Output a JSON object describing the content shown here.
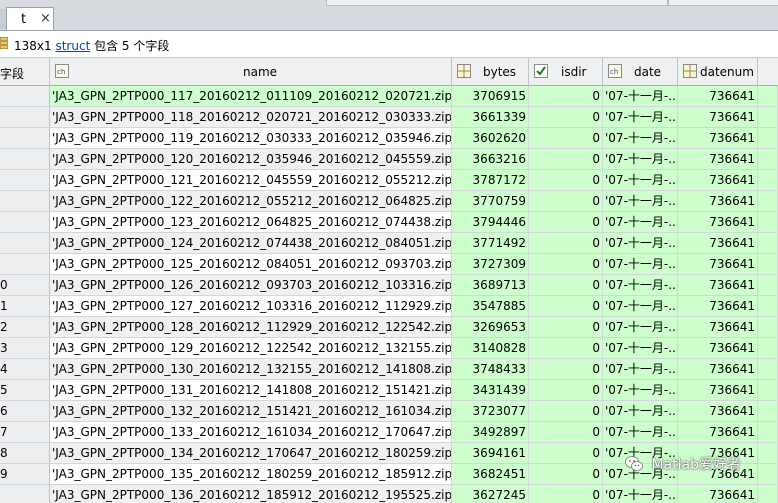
{
  "tab": {
    "label": "t",
    "close": "×"
  },
  "info": {
    "size": "138x1",
    "type_link": "struct",
    "suffix": "包含 5 个字段"
  },
  "columns": {
    "index": "字段",
    "name": "name",
    "bytes": "bytes",
    "isdir": "isdir",
    "date": "date",
    "datenum": "datenum"
  },
  "rows": [
    {
      "idx": "",
      "name": "'JA3_GPN_2PTP000_117_20160212_011109_20160212_020721.zip'",
      "bytes": "3706915",
      "isdir": "0",
      "date": "'07-十一月-...",
      "datenum": "736641"
    },
    {
      "idx": "",
      "name": "'JA3_GPN_2PTP000_118_20160212_020721_20160212_030333.zip'",
      "bytes": "3661339",
      "isdir": "0",
      "date": "'07-十一月-...",
      "datenum": "736641"
    },
    {
      "idx": "",
      "name": "'JA3_GPN_2PTP000_119_20160212_030333_20160212_035946.zip'",
      "bytes": "3602620",
      "isdir": "0",
      "date": "'07-十一月-...",
      "datenum": "736641"
    },
    {
      "idx": "",
      "name": "'JA3_GPN_2PTP000_120_20160212_035946_20160212_045559.zip'",
      "bytes": "3663216",
      "isdir": "0",
      "date": "'07-十一月-...",
      "datenum": "736641"
    },
    {
      "idx": "",
      "name": "'JA3_GPN_2PTP000_121_20160212_045559_20160212_055212.zip'",
      "bytes": "3787172",
      "isdir": "0",
      "date": "'07-十一月-...",
      "datenum": "736641"
    },
    {
      "idx": "",
      "name": "'JA3_GPN_2PTP000_122_20160212_055212_20160212_064825.zip'",
      "bytes": "3770759",
      "isdir": "0",
      "date": "'07-十一月-...",
      "datenum": "736641"
    },
    {
      "idx": "",
      "name": "'JA3_GPN_2PTP000_123_20160212_064825_20160212_074438.zip'",
      "bytes": "3794446",
      "isdir": "0",
      "date": "'07-十一月-...",
      "datenum": "736641"
    },
    {
      "idx": "",
      "name": "'JA3_GPN_2PTP000_124_20160212_074438_20160212_084051.zip'",
      "bytes": "3771492",
      "isdir": "0",
      "date": "'07-十一月-...",
      "datenum": "736641"
    },
    {
      "idx": "",
      "name": "'JA3_GPN_2PTP000_125_20160212_084051_20160212_093703.zip'",
      "bytes": "3727309",
      "isdir": "0",
      "date": "'07-十一月-...",
      "datenum": "736641"
    },
    {
      "idx": "0",
      "name": "'JA3_GPN_2PTP000_126_20160212_093703_20160212_103316.zip'",
      "bytes": "3689713",
      "isdir": "0",
      "date": "'07-十一月-...",
      "datenum": "736641"
    },
    {
      "idx": "1",
      "name": "'JA3_GPN_2PTP000_127_20160212_103316_20160212_112929.zip'",
      "bytes": "3547885",
      "isdir": "0",
      "date": "'07-十一月-...",
      "datenum": "736641"
    },
    {
      "idx": "2",
      "name": "'JA3_GPN_2PTP000_128_20160212_112929_20160212_122542.zip'",
      "bytes": "3269653",
      "isdir": "0",
      "date": "'07-十一月-...",
      "datenum": "736641"
    },
    {
      "idx": "3",
      "name": "'JA3_GPN_2PTP000_129_20160212_122542_20160212_132155.zip'",
      "bytes": "3140828",
      "isdir": "0",
      "date": "'07-十一月-...",
      "datenum": "736641"
    },
    {
      "idx": "4",
      "name": "'JA3_GPN_2PTP000_130_20160212_132155_20160212_141808.zip'",
      "bytes": "3748433",
      "isdir": "0",
      "date": "'07-十一月-...",
      "datenum": "736641"
    },
    {
      "idx": "5",
      "name": "'JA3_GPN_2PTP000_131_20160212_141808_20160212_151421.zip'",
      "bytes": "3431439",
      "isdir": "0",
      "date": "'07-十一月-...",
      "datenum": "736641"
    },
    {
      "idx": "6",
      "name": "'JA3_GPN_2PTP000_132_20160212_151421_20160212_161034.zip'",
      "bytes": "3723077",
      "isdir": "0",
      "date": "'07-十一月-...",
      "datenum": "736641"
    },
    {
      "idx": "7",
      "name": "'JA3_GPN_2PTP000_133_20160212_161034_20160212_170647.zip'",
      "bytes": "3492897",
      "isdir": "0",
      "date": "'07-十一月-...",
      "datenum": "736641"
    },
    {
      "idx": "8",
      "name": "'JA3_GPN_2PTP000_134_20160212_170647_20160212_180259.zip'",
      "bytes": "3694161",
      "isdir": "0",
      "date": "'07-十一月-...",
      "datenum": "736641"
    },
    {
      "idx": "9",
      "name": "'JA3_GPN_2PTP000_135_20160212_180259_20160212_185912.zip'",
      "bytes": "3682451",
      "isdir": "0",
      "date": "'07-十一月-...",
      "datenum": "736641"
    },
    {
      "idx": "",
      "name": "'JA3_GPN_2PTP000_136_20160212_185912_20160212_195525.zip'",
      "bytes": "3627245",
      "isdir": "0",
      "date": "'07-十一月-...",
      "datenum": "736641"
    }
  ],
  "watermark": "Matlab爱好者",
  "colors": {
    "numeric_fill": "#ccffcc",
    "header_bg": "#eef0f2",
    "link": "#0645ad"
  }
}
